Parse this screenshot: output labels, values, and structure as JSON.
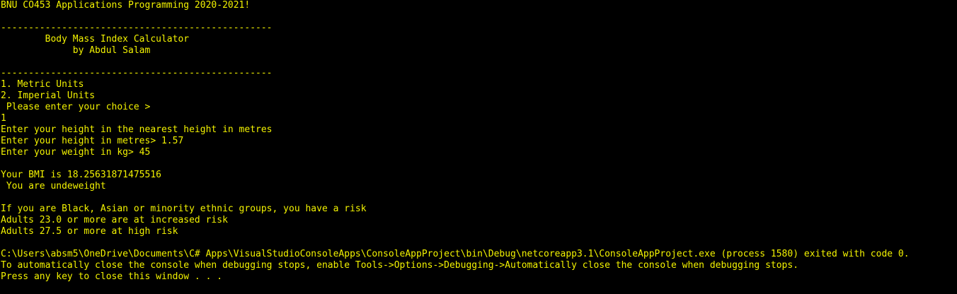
{
  "console": {
    "text_color": "#f2f200",
    "background_color": "#000000",
    "lines": [
      "BNU CO453 Applications Programming 2020-2021!",
      "",
      "-------------------------------------------------",
      "        Body Mass Index Calculator",
      "             by Abdul Salam",
      "",
      "-------------------------------------------------",
      "1. Metric Units",
      "2. Imperial Units",
      " Please enter your choice >",
      "1",
      "Enter your height in the nearest height in metres",
      "Enter your height in metres> 1.57",
      "Enter your weight in kg> 45",
      "",
      "Your BMI is 18.25631871475516",
      " You are undeweight",
      "",
      "If you are Black, Asian or minority ethnic groups, you have a risk",
      "Adults 23.0 or more are at increased risk",
      "Adults 27.5 or more at high risk",
      "",
      "C:\\Users\\absm5\\OneDrive\\Documents\\C# Apps\\VisualStudioConsoleApps\\ConsoleAppProject\\bin\\Debug\\netcoreapp3.1\\ConsoleAppProject.exe (process 1580) exited with code 0.",
      "To automatically close the console when debugging stops, enable Tools->Options->Debugging->Automatically close the console when debugging stops.",
      "Press any key to close this window . . ."
    ]
  }
}
